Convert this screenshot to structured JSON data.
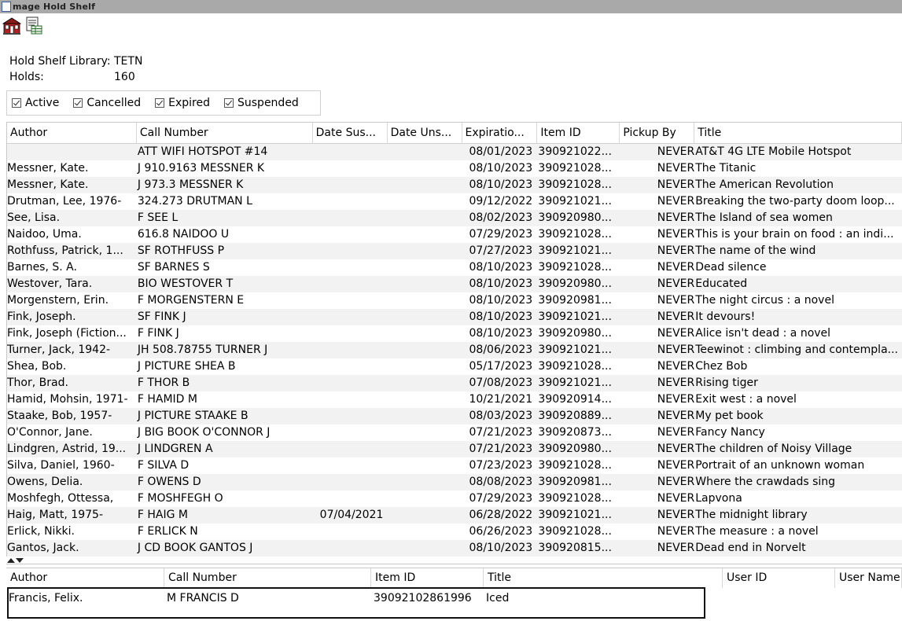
{
  "window": {
    "title": "mage Hold Shelf"
  },
  "toolbar": {
    "icons": [
      "library-building-icon",
      "hold-list-icon"
    ]
  },
  "info": {
    "library_label": "Hold Shelf Library:",
    "library_value": "TETN",
    "holds_label": "Holds:",
    "holds_value": "160"
  },
  "filters": [
    {
      "label": "Active",
      "checked": true
    },
    {
      "label": "Cancelled",
      "checked": true
    },
    {
      "label": "Expired",
      "checked": true
    },
    {
      "label": "Suspended",
      "checked": true
    }
  ],
  "grid": {
    "columns": [
      "Author",
      "Call Number",
      "Date Sus...",
      "Date Uns...",
      "Expiratio...",
      "Item ID",
      "Pickup By",
      "Title"
    ],
    "rows": [
      [
        "",
        "ATT WIFI HOTSPOT #14",
        "",
        "",
        "08/01/2023",
        "390921022...",
        "NEVER",
        "AT&T 4G LTE Mobile Hotspot"
      ],
      [
        "Messner, Kate.",
        "J 910.9163 MESSNER K",
        "",
        "",
        "08/10/2023",
        "390921028...",
        "NEVER",
        "The Titanic"
      ],
      [
        "Messner, Kate.",
        "J 973.3 MESSNER K",
        "",
        "",
        "08/10/2023",
        "390921028...",
        "NEVER",
        "The American Revolution"
      ],
      [
        "Drutman, Lee, 1976-",
        "324.273 DRUTMAN L",
        "",
        "",
        "09/12/2022",
        "390921021...",
        "NEVER",
        "Breaking the two-party doom loop..."
      ],
      [
        "See, Lisa.",
        "F SEE L",
        "",
        "",
        "08/02/2023",
        "390920980...",
        "NEVER",
        "The Island of sea women"
      ],
      [
        "Naidoo, Uma.",
        "616.8 NAIDOO U",
        "",
        "",
        "07/29/2023",
        "390921028...",
        "NEVER",
        "This is your brain on food : an indi..."
      ],
      [
        "Rothfuss, Patrick, 1...",
        "SF ROTHFUSS P",
        "",
        "",
        "07/27/2023",
        "390921021...",
        "NEVER",
        "The name of the wind"
      ],
      [
        "Barnes, S. A.",
        "SF BARNES S",
        "",
        "",
        "08/10/2023",
        "390921028...",
        "NEVER",
        "Dead silence"
      ],
      [
        "Westover, Tara.",
        "BIO WESTOVER T",
        "",
        "",
        "08/10/2023",
        "390920980...",
        "NEVER",
        "Educated"
      ],
      [
        "Morgenstern, Erin.",
        "F MORGENSTERN E",
        "",
        "",
        "08/10/2023",
        "390920981...",
        "NEVER",
        "The night circus : a novel"
      ],
      [
        "Fink, Joseph.",
        "SF FINK J",
        "",
        "",
        "08/10/2023",
        "390921021...",
        "NEVER",
        "It devours!"
      ],
      [
        "Fink, Joseph (Fiction...",
        "F FINK J",
        "",
        "",
        "08/10/2023",
        "390920980...",
        "NEVER",
        "Alice isn't dead : a novel"
      ],
      [
        "Turner, Jack, 1942-",
        "JH 508.78755 TURNER J",
        "",
        "",
        "08/06/2023",
        "390921021...",
        "NEVER",
        "Teewinot : climbing and contempla..."
      ],
      [
        "Shea, Bob.",
        "J PICTURE SHEA B",
        "",
        "",
        "05/17/2023",
        "390921028...",
        "NEVER",
        "Chez Bob"
      ],
      [
        "Thor, Brad.",
        "F THOR B",
        "",
        "",
        "07/08/2023",
        "390921021...",
        "NEVER",
        "Rising tiger"
      ],
      [
        "Hamid, Mohsin, 1971-",
        "F HAMID M",
        "",
        "",
        "10/21/2021",
        "390920914...",
        "NEVER",
        "Exit west : a novel"
      ],
      [
        "Staake, Bob, 1957-",
        "J PICTURE STAAKE B",
        "",
        "",
        "08/03/2023",
        "390920889...",
        "NEVER",
        "My pet book"
      ],
      [
        "O'Connor, Jane.",
        "J BIG BOOK O'CONNOR J",
        "",
        "",
        "07/21/2023",
        "390920873...",
        "NEVER",
        "Fancy Nancy"
      ],
      [
        "Lindgren, Astrid, 19...",
        "J LINDGREN A",
        "",
        "",
        "07/21/2023",
        "390920980...",
        "NEVER",
        "The children of Noisy Village"
      ],
      [
        "Silva, Daniel, 1960-",
        "F SILVA D",
        "",
        "",
        "07/23/2023",
        "390921028...",
        "NEVER",
        "Portrait of an unknown woman"
      ],
      [
        "Owens, Delia.",
        "F OWENS D",
        "",
        "",
        "08/08/2023",
        "390920981...",
        "NEVER",
        "Where the crawdads sing"
      ],
      [
        "Moshfegh, Ottessa,",
        "F MOSHFEGH O",
        "",
        "",
        "07/29/2023",
        "390921028...",
        "NEVER",
        "Lapvona"
      ],
      [
        "Haig, Matt, 1975-",
        "F HAIG M",
        "07/04/2021",
        "",
        "06/28/2022",
        "390921021...",
        "NEVER",
        "The midnight library"
      ],
      [
        "Erlick, Nikki.",
        "F ERLICK N",
        "",
        "",
        "06/26/2023",
        "390921028...",
        "NEVER",
        "The measure : a novel"
      ],
      [
        "Gantos, Jack.",
        "J CD BOOK GANTOS J",
        "",
        "",
        "08/10/2023",
        "390920815...",
        "NEVER",
        "Dead end in Norvelt"
      ]
    ]
  },
  "detail": {
    "columns": [
      "Author",
      "Call Number",
      "Item ID",
      "Title",
      "User ID",
      "User Name"
    ],
    "row": {
      "author": "Francis, Felix.",
      "call_number": "M FRANCIS D",
      "item_id": "39092102861996",
      "title": "Iced"
    }
  }
}
